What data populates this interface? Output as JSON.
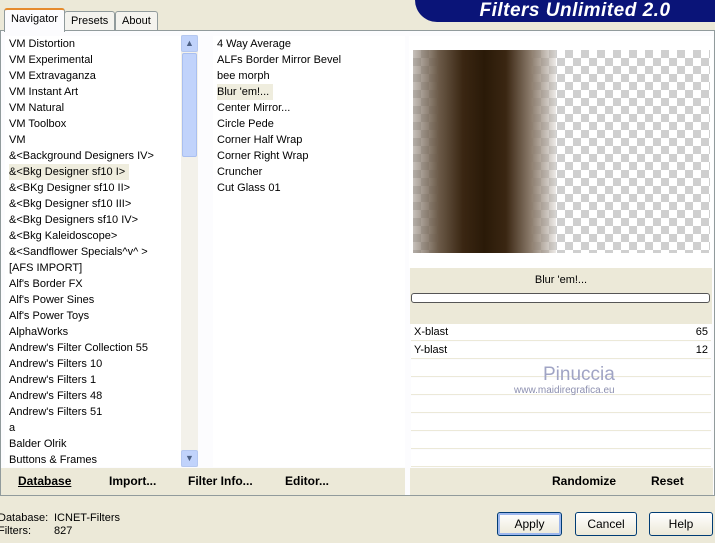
{
  "title": "Filters Unlimited 2.0",
  "tabs": [
    "Navigator",
    "Presets",
    "About"
  ],
  "categories": [
    "VM Distortion",
    "VM Experimental",
    "VM Extravaganza",
    "VM Instant Art",
    "VM Natural",
    "VM Toolbox",
    "VM",
    "&<Background Designers IV>",
    "&<Bkg Designer sf10 I>",
    "&<BKg Designer sf10 II>",
    "&<Bkg Designer sf10 III>",
    "&<Bkg Designers sf10 IV>",
    "&<Bkg Kaleidoscope>",
    "&<Sandflower Specials^v^ >",
    "[AFS IMPORT]",
    "Alf's Border FX",
    "Alf's Power Sines",
    "Alf's Power Toys",
    "AlphaWorks",
    "Andrew's Filter Collection 55",
    "Andrew's Filters 10",
    "Andrew's Filters 1",
    "Andrew's Filters 48",
    "Andrew's Filters 51",
    "a",
    "Balder Olrik",
    "Buttons & Frames"
  ],
  "selected_category": "&<Bkg Designer sf10 I>",
  "filters": [
    "4 Way Average",
    "ALFs Border Mirror Bevel",
    "bee morph",
    "Blur 'em!...",
    "Center Mirror...",
    "Circle Pede",
    "Corner Half Wrap",
    "Corner Right Wrap",
    "Cruncher",
    "Cut Glass 01"
  ],
  "selected_filter": "Blur 'em!...",
  "filter_name": "Blur 'em!...",
  "params": [
    {
      "label": "X-blast",
      "value": "65"
    },
    {
      "label": "Y-blast",
      "value": "12"
    }
  ],
  "watermark": {
    "name": "Pinuccia",
    "url": "www.maidiregrafica.eu"
  },
  "left_buttons": [
    "Database",
    "Import...",
    "Filter Info...",
    "Editor..."
  ],
  "right_buttons": [
    "Randomize",
    "Reset"
  ],
  "status": {
    "database_label": "Database:",
    "database_value": "ICNET-Filters",
    "filters_label": "Filters:",
    "filters_value": "827"
  },
  "dialog_buttons": [
    "Apply",
    "Cancel",
    "Help"
  ]
}
